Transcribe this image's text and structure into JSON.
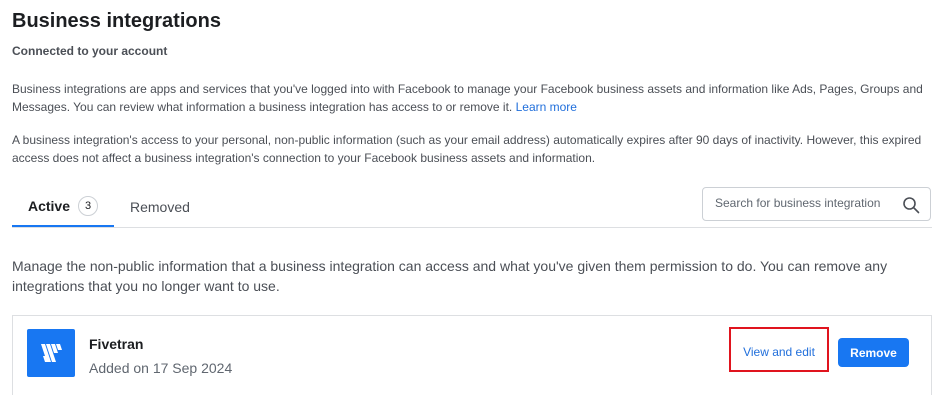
{
  "header": {
    "title": "Business integrations",
    "subtitle": "Connected to your account"
  },
  "intro": {
    "text": "Business integrations are apps and services that you've logged into with Facebook to manage your Facebook business assets and information like Ads, Pages, Groups and Messages. You can review what information a business integration has access to or remove it.",
    "learn_more": "Learn more"
  },
  "notice": {
    "text": "A business integration's access to your personal, non-public information (such as your email address) automatically expires after 90 days of inactivity. However, this expired access does not affect a business integration's connection to your Facebook business assets and information."
  },
  "tabs": [
    {
      "label": "Active",
      "count": "3",
      "selected": true
    },
    {
      "label": "Removed"
    }
  ],
  "search": {
    "placeholder": "Search for business integration",
    "icon": "search-icon"
  },
  "description": "Manage the non-public information that a business integration can access and what you've given them permission to do. You can remove any integrations that you no longer want to use.",
  "integrations": [
    {
      "name": "Fivetran",
      "added": "Added on 17 Sep 2024",
      "logo_color": "#1877f2",
      "view_label": "View and edit",
      "remove_label": "Remove"
    }
  ],
  "colors": {
    "accent": "#1877f2",
    "link": "#216fdb",
    "highlight": "#e0141e"
  }
}
